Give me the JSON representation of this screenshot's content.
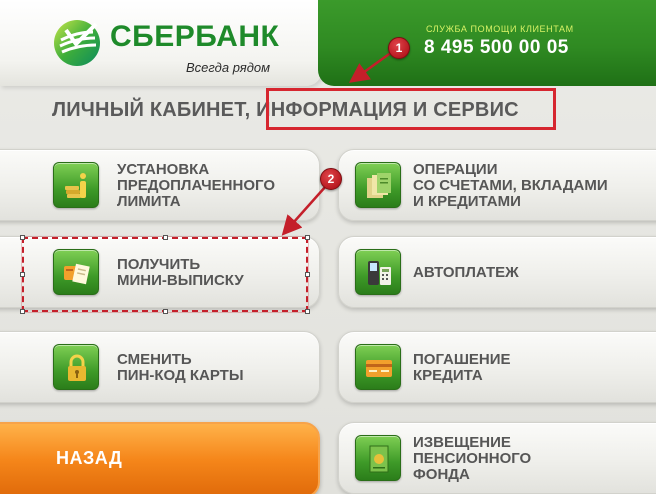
{
  "brand": {
    "name": "СБЕРБАНК",
    "slogan": "Всегда рядом",
    "color": "#1e8a2a"
  },
  "helpdesk": {
    "label": "СЛУЖБА ПОМОЩИ КЛИЕНТАМ",
    "phone": "8 495 500 00 05"
  },
  "page": {
    "title": "ЛИЧНЫЙ КАБИНЕТ, ИНФОРМАЦИЯ И СЕРВИС"
  },
  "menu": {
    "left": [
      {
        "label": "УСТАНОВКА\nПРЕДОПЛАЧЕННОГО\nЛИМИТА",
        "icon": "info-coins-icon"
      },
      {
        "label": "ПОЛУЧИТЬ\nМИНИ-ВЫПИСКУ",
        "icon": "receipt-card-icon"
      },
      {
        "label": "СМЕНИТЬ\nПИН-КОД КАРТЫ",
        "icon": "padlock-icon"
      }
    ],
    "right": [
      {
        "label": "ОПЕРАЦИИ\nСО СЧЕТАМИ, ВКЛАДАМИ\nИ КРЕДИТАМИ",
        "icon": "folders-icon"
      },
      {
        "label": "АВТОПЛАТЕЖ",
        "icon": "phone-calculator-icon"
      },
      {
        "label": "ПОГАШЕНИЕ\nКРЕДИТА",
        "icon": "credit-card-icon"
      },
      {
        "label": "ИЗВЕЩЕНИЕ\nПЕНСИОННОГО\nФОНДА",
        "icon": "document-icon"
      }
    ]
  },
  "back": {
    "label": "НАЗАД",
    "color": "#f5861a"
  },
  "annotations": {
    "marker_1": "1",
    "marker_2": "2",
    "color": "#d6262f"
  }
}
